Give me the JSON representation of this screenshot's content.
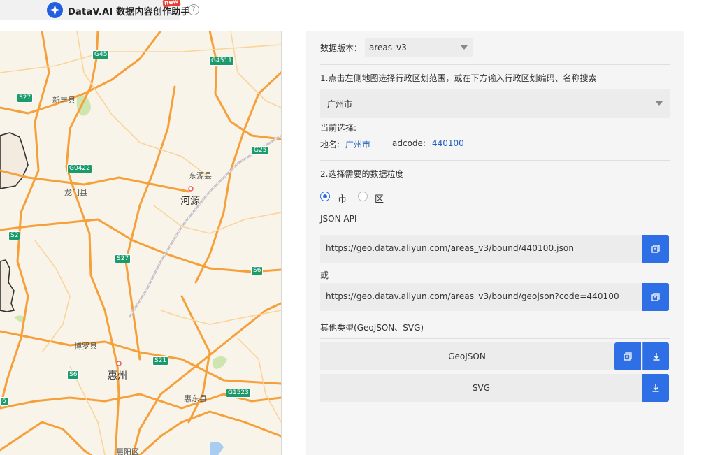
{
  "header": {
    "brand_title": "DataV.AI 数据内容创作助手",
    "new_badge": "new",
    "help_icon": "?"
  },
  "map": {
    "labels": {
      "xinfeng": "新丰县",
      "longmen": "龙门县",
      "dongyuan": "东源县",
      "heyuan": "河源",
      "boluo": "博罗县",
      "huizhou": "惠州",
      "huidong": "惠东县",
      "huiyang": "惠阳区"
    },
    "shields": {
      "g45": "G45",
      "g4511": "G4511",
      "s27a": "S27",
      "g25": "G25",
      "g0422": "G0422",
      "s2": "S2",
      "s27b": "S27",
      "s6a": "S6",
      "s21": "S21",
      "s6b": "S6",
      "g1523": "G1523",
      "s6c": "6"
    }
  },
  "panel": {
    "version_label": "数据版本：",
    "version_value": "areas_v3",
    "step1_text": "1.点击左侧地图选择行政区划范围，或在下方输入行政区划编码、名称搜索",
    "region_select_value": "广州市",
    "current_label": "当前选择:",
    "name_label": "地名:",
    "name_value": "广州市",
    "adcode_label": "adcode:",
    "adcode_value": "440100",
    "step2_text": "2.选择需要的数据粒度",
    "granularity_options": [
      "市",
      "区"
    ],
    "granularity_selected": "市",
    "json_api_label": "JSON API",
    "api_url_1": "https://geo.datav.aliyun.com/areas_v3/bound/440100.json",
    "or_label": "或",
    "api_url_2": "https://geo.datav.aliyun.com/areas_v3/bound/geojson?code=440100",
    "other_types_label": "其他类型(GeoJSON、SVG)",
    "geojson_label": "GeoJSON",
    "svg_label": "SVG"
  },
  "colors": {
    "accent_blue": "#2f6fe6",
    "link_blue": "#1f5fbf",
    "road_orange": "#f5a03a",
    "highway_green": "#1b9a6b"
  }
}
